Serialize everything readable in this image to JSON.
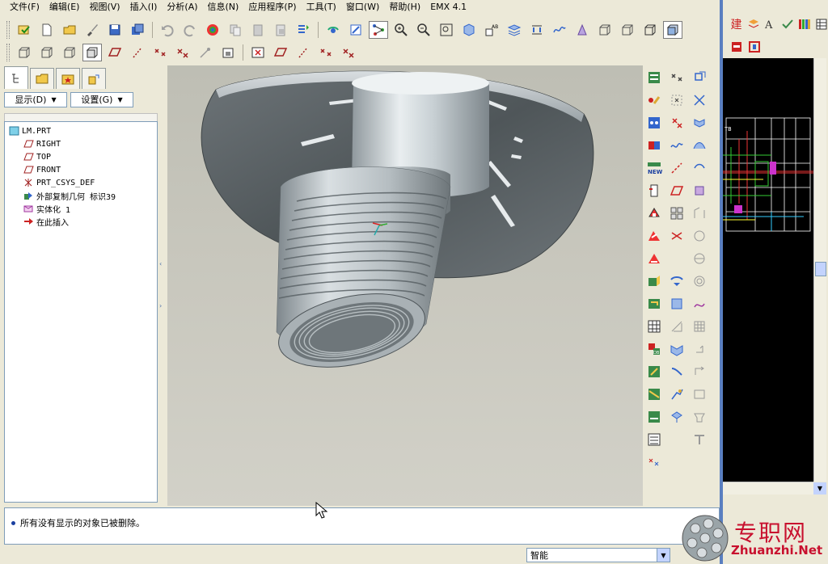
{
  "menubar": {
    "items": [
      "文件(F)",
      "编辑(E)",
      "视图(V)",
      "插入(I)",
      "分析(A)",
      "信息(N)",
      "应用程序(P)",
      "工具(T)",
      "窗口(W)",
      "帮助(H)",
      "EMX 4.1"
    ]
  },
  "left_pane": {
    "show_button": "显示(D)",
    "settings_button": "设置(G)",
    "tree": [
      {
        "label": "LM.PRT",
        "icon": "part-icon"
      },
      {
        "label": "RIGHT",
        "icon": "datum-plane-icon"
      },
      {
        "label": "TOP",
        "icon": "datum-plane-icon"
      },
      {
        "label": "FRONT",
        "icon": "datum-plane-icon"
      },
      {
        "label": "PRT_CSYS_DEF",
        "icon": "csys-icon"
      },
      {
        "label": "外部复制几何 标识39",
        "icon": "copy-geom-icon"
      },
      {
        "label": "实体化 1",
        "icon": "solidify-icon"
      },
      {
        "label": "在此插入",
        "icon": "insert-here-arrow-icon"
      }
    ]
  },
  "message": "所有没有显示的对象已被删除。",
  "filter": {
    "value": "智能"
  },
  "watermark": {
    "cn": "专职网",
    "en": "Zhuanzhi.Net"
  },
  "side_app": {
    "first_icon_text": "建"
  }
}
